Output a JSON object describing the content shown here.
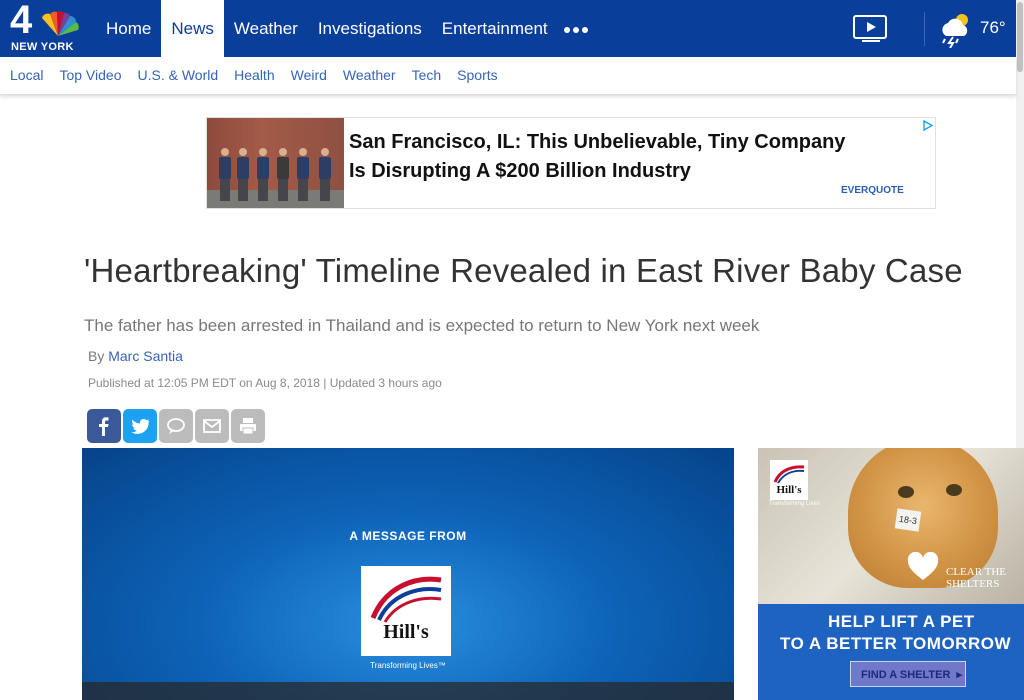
{
  "site": {
    "logo_text": "4",
    "logo_city": "NEW YORK"
  },
  "nav": {
    "items": [
      "Home",
      "News",
      "Weather",
      "Investigations",
      "Entertainment"
    ],
    "active": "News",
    "more_icon": "more-dots-icon",
    "video_icon": "video-play-icon"
  },
  "weather": {
    "icon": "storm-cloud-icon",
    "temperature": "76°"
  },
  "subnav": {
    "items": [
      "Local",
      "Top Video",
      "U.S. & World",
      "Health",
      "Weird",
      "Weather",
      "Tech",
      "Sports"
    ]
  },
  "ad_top": {
    "headline_line1": "San Francisco, IL: This Unbelievable, Tiny Company",
    "headline_line2": "Is Disrupting A $200 Billion Industry",
    "brand": "EVERQUOTE",
    "adchoices_icon": "adchoices-icon"
  },
  "article": {
    "title": "'Heartbreaking' Timeline Revealed in East River Baby Case",
    "subtitle": "The father has been arrested in Thailand and is expected to return to New York next week",
    "byline_prefix": "By",
    "author": "Marc Santia",
    "published": "Published at 12:05 PM EDT on Aug 8, 2018 | Updated 3 hours ago"
  },
  "share": [
    "facebook-icon",
    "twitter-icon",
    "comment-icon",
    "email-icon",
    "print-icon"
  ],
  "video": {
    "message": "A MESSAGE FROM",
    "brand": "Hill's",
    "tagline": "Transforming Lives™"
  },
  "side_ad": {
    "brand": "Hill's",
    "brand_tagline": "Transforming Lives",
    "collar_tag": "18-3",
    "campaign": "CLEAR THE SHELTERS",
    "line1": "HELP LIFT A PET",
    "line2": "TO A BETTER TOMORROW",
    "button": "FIND A SHELTER"
  },
  "colors": {
    "nav_bg": "#0a3e9b",
    "link": "#3763b8",
    "facebook": "#3b5998",
    "twitter": "#1da1f2"
  }
}
